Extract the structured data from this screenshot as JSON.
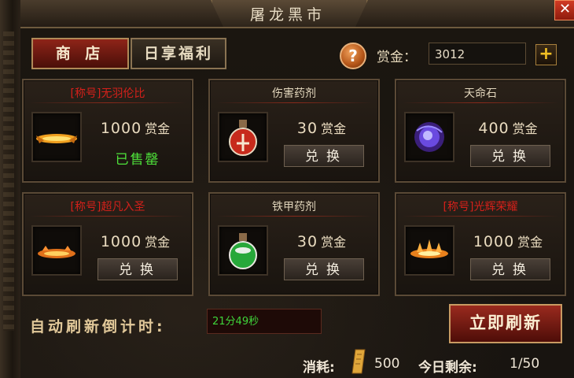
{
  "window": {
    "title": "屠龙黑市",
    "close_label": "✕"
  },
  "tabs": [
    {
      "label": "商 店",
      "active": true
    },
    {
      "label": "日享福利",
      "active": false
    }
  ],
  "currency": {
    "label": "赏金：",
    "value": "3012",
    "help_label": "?",
    "add_label": "+"
  },
  "items": [
    {
      "name": "[称号]无羽伦比",
      "name_color": "red",
      "price": "1000",
      "unit": "赏金",
      "status": "已售罄",
      "button": "",
      "icon": "golden-wings-title-icon"
    },
    {
      "name": "伤害药剂",
      "name_color": "normal",
      "price": "30",
      "unit": "赏金",
      "status": "",
      "button": "兑换",
      "icon": "red-potion-icon"
    },
    {
      "name": "天命石",
      "name_color": "normal",
      "price": "400",
      "unit": "赏金",
      "status": "",
      "button": "兑换",
      "icon": "purple-orb-icon"
    },
    {
      "name": "[称号]超凡入圣",
      "name_color": "red",
      "price": "1000",
      "unit": "赏金",
      "status": "",
      "button": "兑换",
      "icon": "fire-title-icon"
    },
    {
      "name": "铁甲药剂",
      "name_color": "normal",
      "price": "30",
      "unit": "赏金",
      "status": "",
      "button": "兑换",
      "icon": "green-potion-icon"
    },
    {
      "name": "[称号]光辉荣耀",
      "name_color": "red",
      "price": "1000",
      "unit": "赏金",
      "status": "",
      "button": "兑换",
      "icon": "flame-title-icon"
    }
  ],
  "refresh": {
    "label": "自动刷新倒计时:",
    "countdown": "21分49秒",
    "button": "立即刷新"
  },
  "footer": {
    "cost_label": "消耗:",
    "cost_value": "500",
    "remaining_label": "今日剩余:",
    "remaining_value": "1/50"
  },
  "colors": {
    "accent_red": "#9a2a1e",
    "title_red": "#d4201a",
    "sold_out_green": "#4ee23a",
    "gold": "#f2c024"
  }
}
